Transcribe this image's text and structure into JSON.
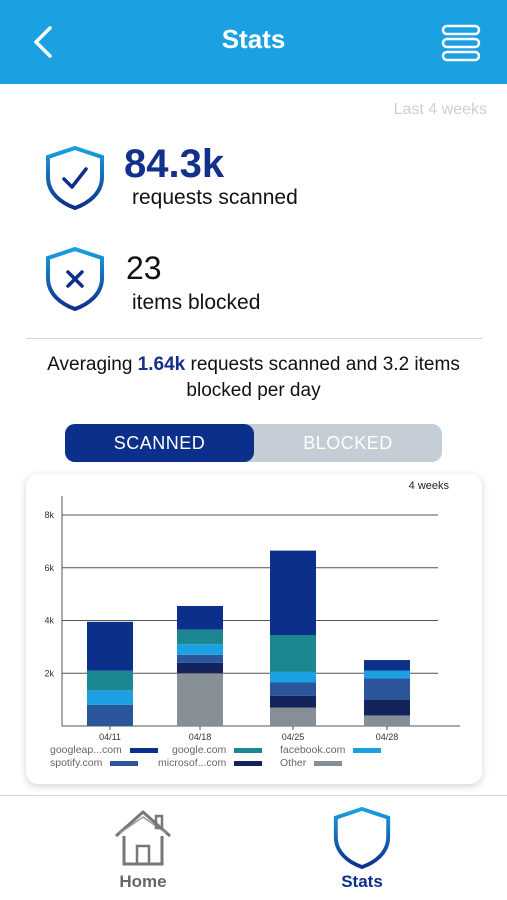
{
  "header": {
    "title": "Stats",
    "back_icon": "chevron-left-icon",
    "menu_icon": "hamburger-menu-icon",
    "bg_color": "#1ba0e2"
  },
  "period_label": "Last 4 weeks",
  "stats": {
    "scanned_value": "84.3k",
    "scanned_label": "requests scanned",
    "blocked_value": "23",
    "blocked_label": "items blocked"
  },
  "summary": {
    "prefix": "Averaging ",
    "highlight": "1.64k",
    "suffix": " requests scanned and 3.2 items blocked per day"
  },
  "toggle": {
    "active": "SCANNED",
    "inactive": "BLOCKED"
  },
  "chart_data": {
    "type": "bar",
    "stacked": true,
    "period_label": "4 weeks",
    "categories": [
      "04/11",
      "04/18",
      "04/25",
      "04/28"
    ],
    "ylim": [
      0,
      8000
    ],
    "yticks": [
      2000,
      4000,
      6000,
      8000
    ],
    "ytick_labels": [
      "2k",
      "4k",
      "6k",
      "8k"
    ],
    "grid": true,
    "legend_position": "bottom",
    "series": [
      {
        "name": "Other",
        "color": "#868e96",
        "values": [
          0,
          2000,
          700,
          400
        ]
      },
      {
        "name": "microsof...com",
        "color": "#13245c",
        "values": [
          0,
          400,
          450,
          600
        ]
      },
      {
        "name": "spotify.com",
        "color": "#2b569b",
        "values": [
          800,
          300,
          500,
          800
        ]
      },
      {
        "name": "facebook.com",
        "color": "#1ba0e2",
        "values": [
          550,
          400,
          400,
          300
        ]
      },
      {
        "name": "google.com",
        "color": "#1a8793",
        "values": [
          750,
          550,
          1400,
          0
        ]
      },
      {
        "name": "googleap...com",
        "color": "#0d2f8c",
        "values": [
          1850,
          900,
          3200,
          400
        ]
      }
    ],
    "legend_order": [
      "googleap...com",
      "google.com",
      "facebook.com",
      "spotify.com",
      "microsof...com",
      "Other"
    ]
  },
  "tabs": [
    {
      "label": "Home",
      "icon": "home-icon",
      "active": false
    },
    {
      "label": "Stats",
      "icon": "shield-icon",
      "active": true
    }
  ]
}
